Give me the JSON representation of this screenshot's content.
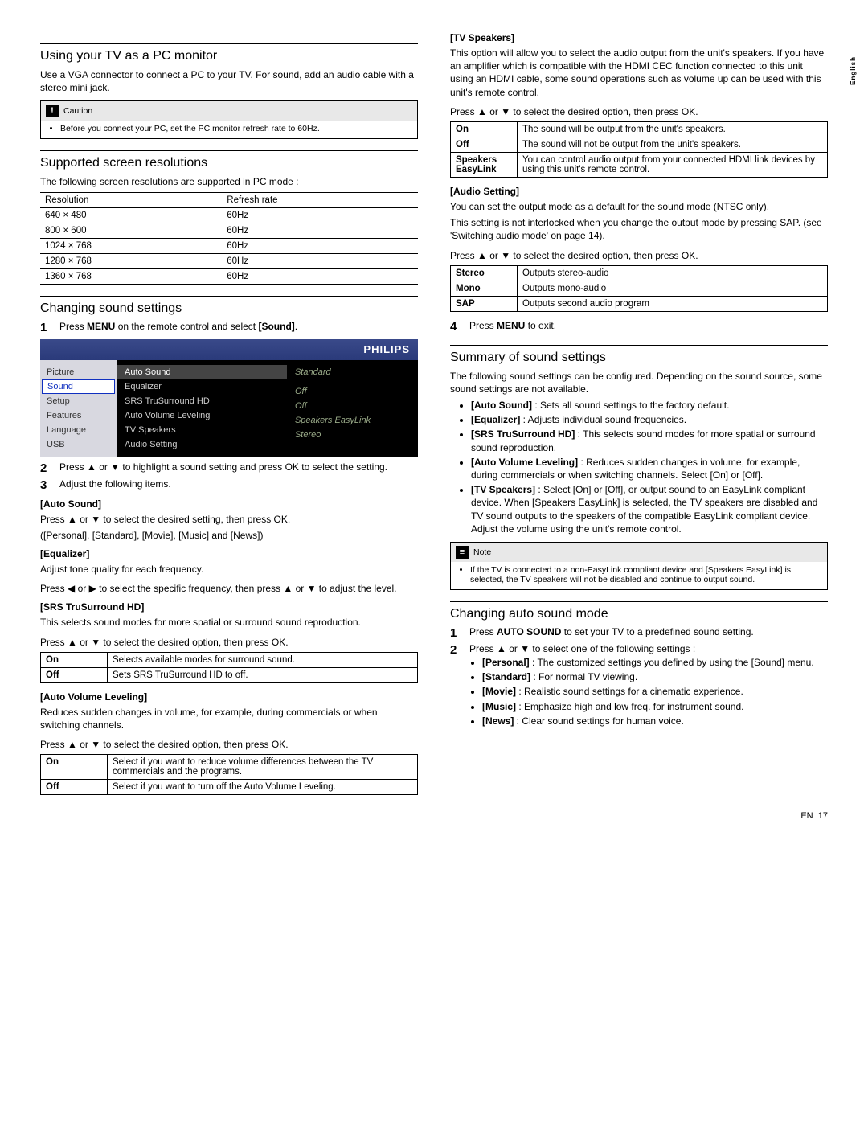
{
  "lang_tab": "English",
  "footer": {
    "lang": "EN",
    "page": "17"
  },
  "left": {
    "h1": "Using your TV as a PC monitor",
    "p1": "Use a VGA connector to connect a PC to your TV. For sound, add an audio cable with a stereo mini jack.",
    "caution": {
      "title": "Caution",
      "text": "Before you connect your PC, set the PC monitor refresh rate to 60Hz."
    },
    "h2": "Supported screen resolutions",
    "p2": "The following screen resolutions are supported in PC mode :",
    "res_table": {
      "head": [
        "Resolution",
        "Refresh rate"
      ],
      "rows": [
        [
          "640 × 480",
          "60Hz"
        ],
        [
          "800 × 600",
          "60Hz"
        ],
        [
          "1024 × 768",
          "60Hz"
        ],
        [
          "1280 × 768",
          "60Hz"
        ],
        [
          "1360 × 768",
          "60Hz"
        ]
      ]
    },
    "h3": "Changing sound settings",
    "step1": {
      "a": "Press ",
      "b": "MENU",
      "c": " on the remote control and select ",
      "d": "[Sound]",
      "e": "."
    },
    "tv": {
      "brand": "PHILIPS",
      "left": [
        "Picture",
        "Sound",
        "Setup",
        "Features",
        "Language",
        "USB"
      ],
      "col1": [
        "Auto Sound",
        "Equalizer",
        "SRS TruSurround HD",
        "Auto Volume Leveling",
        "TV Speakers",
        "Audio Setting"
      ],
      "col2": [
        "Standard",
        "",
        "Off",
        "Off",
        "Speakers EasyLink",
        "Stereo"
      ]
    },
    "step2": "Press ▲ or ▼ to highlight a sound setting and press OK to select the setting.",
    "step3": "Adjust the following items.",
    "auto_sound": {
      "h": "[Auto Sound]",
      "p1": "Press ▲ or ▼ to select the desired setting, then press OK.",
      "p2": "([Personal], [Standard], [Movie], [Music] and [News])"
    },
    "equalizer": {
      "h": "[Equalizer]",
      "p1": "Adjust tone quality for each frequency.",
      "p2": "Press ◀ or ▶ to select the specific frequency, then press ▲ or ▼ to adjust the level."
    },
    "srs": {
      "h": "[SRS TruSurround HD]",
      "p1": "This selects sound modes for more spatial or surround sound reproduction.",
      "p2": "Press ▲ or ▼ to select the desired option, then press OK.",
      "rows": [
        [
          "On",
          "Selects available modes for surround sound."
        ],
        [
          "Off",
          "Sets SRS TruSurround HD to off."
        ]
      ]
    },
    "avl": {
      "h": "[Auto Volume Leveling]",
      "p1": "Reduces sudden changes in volume, for example, during commercials or when switching channels.",
      "p2": "Press ▲ or ▼ to select the desired option, then press OK.",
      "rows": [
        [
          "On",
          "Select if you want to reduce volume differences between the TV commercials and the programs."
        ],
        [
          "Off",
          "Select if you want to turn off the Auto Volume Leveling."
        ]
      ]
    }
  },
  "right": {
    "tvspk": {
      "h": "[TV Speakers]",
      "p1": "This option will allow you to select the audio output from the unit's speakers. If you have an amplifier which is compatible with the HDMI CEC function connected to this unit using an HDMI cable, some sound operations such as volume up can be used with this unit's remote control.",
      "p2": "Press ▲ or ▼ to select the desired option, then press OK.",
      "rows": [
        [
          "On",
          "The sound will be output from the unit's speakers."
        ],
        [
          "Off",
          "The sound will not be output from the unit's speakers."
        ],
        [
          "Speakers EasyLink",
          "You can control audio output from your connected HDMI link devices by using this unit's remote control."
        ]
      ]
    },
    "audio": {
      "h": "[Audio Setting]",
      "p1": "You can set the output mode as a default for the sound mode (NTSC only).",
      "p2": "This setting is not interlocked when you change the output mode by pressing SAP. (see 'Switching audio mode' on page 14).",
      "p3": "Press ▲ or ▼ to select the desired option, then press OK.",
      "rows": [
        [
          "Stereo",
          "Outputs stereo-audio"
        ],
        [
          "Mono",
          "Outputs mono-audio"
        ],
        [
          "SAP",
          "Outputs second audio program"
        ]
      ]
    },
    "step4": {
      "a": "Press ",
      "b": "MENU",
      "c": " to exit."
    },
    "h4": "Summary of sound settings",
    "p4": "The following sound settings can be configured. Depending on the sound source, some sound settings are not available.",
    "summary": [
      {
        "b": "[Auto Sound]",
        "t": " : Sets all sound settings to the factory default."
      },
      {
        "b": "[Equalizer]",
        "t": " : Adjusts individual sound frequencies."
      },
      {
        "b": "[SRS TruSurround HD]",
        "t": " : This selects sound modes for more spatial or surround sound reproduction."
      },
      {
        "b": "[Auto Volume Leveling]",
        "t": " : Reduces sudden changes in volume, for example, during commercials or when switching channels. Select [On] or [Off]."
      },
      {
        "b": "[TV Speakers]",
        "t": " : Select [On] or [Off], or output sound to an EasyLink compliant device. When [Speakers EasyLink] is selected, the TV speakers are disabled and TV sound outputs to the speakers of the compatible EasyLink compliant device. Adjust the volume using the unit's remote control."
      }
    ],
    "note": {
      "title": "Note",
      "text": "If the TV is connected to a non-EasyLink compliant device and [Speakers EasyLink] is selected, the TV speakers will not be disabled and continue to output sound."
    },
    "h5": "Changing auto sound mode",
    "step1b": {
      "a": "Press ",
      "b": "AUTO SOUND",
      "c": " to set your TV to a predefined sound setting."
    },
    "step2b": "Press ▲ or ▼ to select one of the following settings :",
    "modes": [
      {
        "b": "[Personal]",
        "t": " : The customized settings you defined by using the [Sound] menu."
      },
      {
        "b": "[Standard]",
        "t": " : For normal TV viewing."
      },
      {
        "b": "[Movie]",
        "t": " : Realistic sound settings for a cinematic experience."
      },
      {
        "b": "[Music]",
        "t": " : Emphasize high and low freq. for instrument sound."
      },
      {
        "b": "[News]",
        "t": " : Clear sound settings for human voice."
      }
    ]
  }
}
